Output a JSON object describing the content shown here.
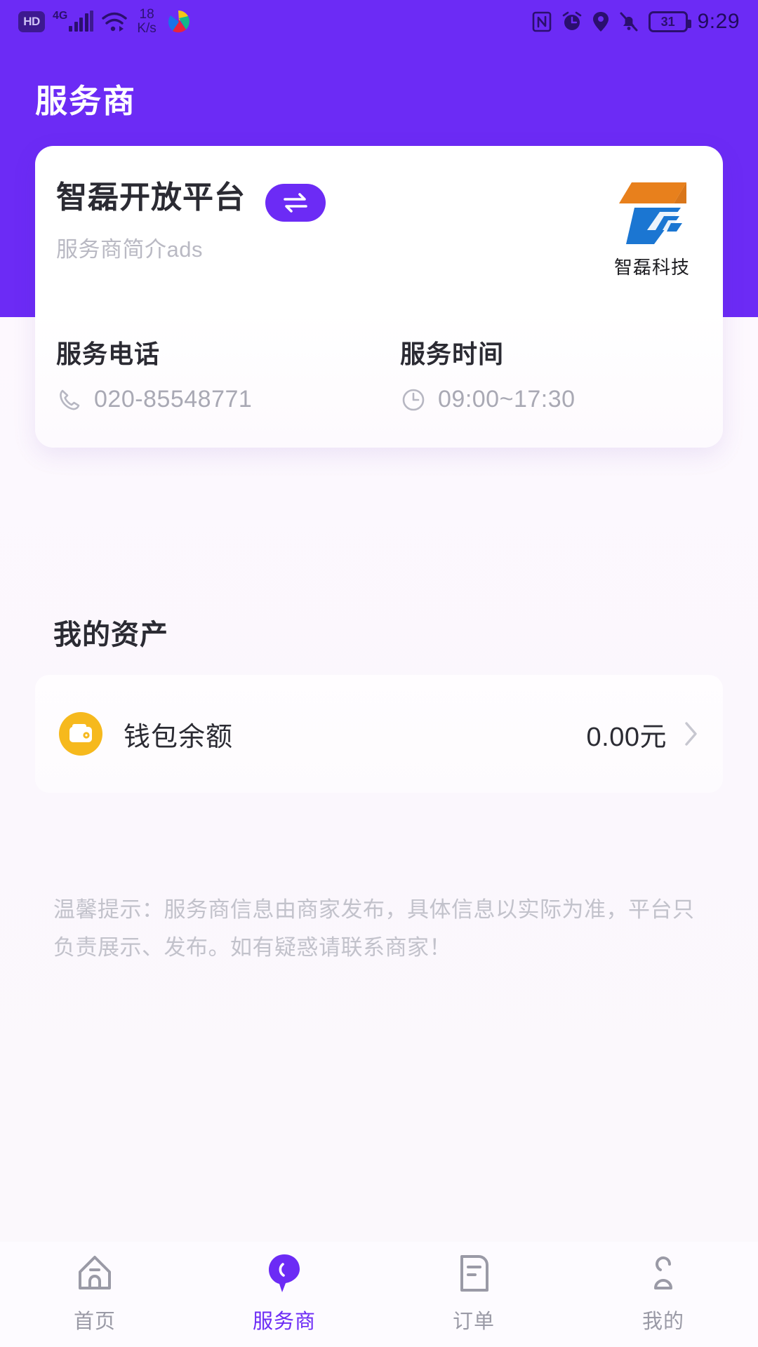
{
  "status_bar": {
    "hd_label": "HD",
    "network_label": "4G",
    "net_speed_value": "18",
    "net_speed_unit": "K/s",
    "icons": [
      "hd-icon",
      "signal-icon",
      "wifi-icon",
      "colorful-app-icon",
      "nfc-icon",
      "alarm-icon",
      "location-icon",
      "silent-bell-icon",
      "battery-icon"
    ],
    "battery_level": "31",
    "time": "9:29"
  },
  "header": {
    "title": "服务商",
    "background_color": "#6c2bf5"
  },
  "provider_card": {
    "name": "智磊开放平台",
    "description": "服务商简介ads",
    "switch_badge_icon": "swap-arrows-icon",
    "brand": {
      "name": "智磊科技",
      "logo_colors": [
        "#e8801c",
        "#1b76d2"
      ]
    },
    "contacts": [
      {
        "label": "服务电话",
        "value": "020-85548771",
        "icon": "phone-icon"
      },
      {
        "label": "服务时间",
        "value": "09:00~17:30",
        "icon": "clock-icon"
      }
    ]
  },
  "assets": {
    "title": "我的资产",
    "items": [
      {
        "label": "钱包余额",
        "amount": "0.00元",
        "icon": "wallet-icon",
        "icon_color": "#f6b91d",
        "chevron": "chevron-right-icon"
      }
    ]
  },
  "tip": "温馨提示：服务商信息由商家发布，具体信息以实际为准，平台只负责展示、发布。如有疑惑请联系商家！",
  "tabbar": {
    "active_color": "#6c2bf5",
    "inactive_color": "#9a9aa6",
    "items": [
      {
        "label": "首页",
        "icon": "home-icon",
        "active": false
      },
      {
        "label": "服务商",
        "icon": "service-chat-icon",
        "active": true
      },
      {
        "label": "订单",
        "icon": "order-doc-icon",
        "active": false
      },
      {
        "label": "我的",
        "icon": "person-icon",
        "active": false
      }
    ]
  }
}
